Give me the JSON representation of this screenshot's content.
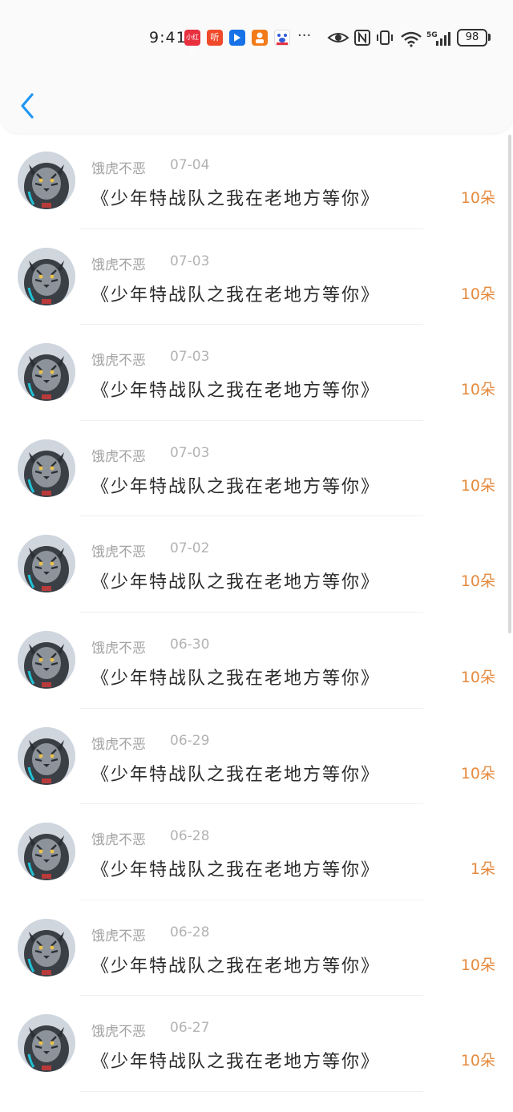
{
  "status_bar": {
    "time": "9:41",
    "apps": [
      {
        "name": "xiaohongshu-icon",
        "label": "小红书",
        "color": "#e8303f"
      },
      {
        "name": "listen-app-icon",
        "label": "听",
        "color": "#f04a2b"
      },
      {
        "name": "feishu-icon",
        "label": "",
        "color": "#1672e6"
      },
      {
        "name": "person-app-icon",
        "label": "",
        "color": "#f27b1b"
      },
      {
        "name": "baidu-icon",
        "label": "",
        "color": "#2f5bd7"
      }
    ],
    "more": "···",
    "battery": "98"
  },
  "list": {
    "items": [
      {
        "name": "饿虎不恶",
        "date": "07-04",
        "title": "《少年特战队之我在老地方等你》",
        "count": "10朵"
      },
      {
        "name": "饿虎不恶",
        "date": "07-03",
        "title": "《少年特战队之我在老地方等你》",
        "count": "10朵"
      },
      {
        "name": "饿虎不恶",
        "date": "07-03",
        "title": "《少年特战队之我在老地方等你》",
        "count": "10朵"
      },
      {
        "name": "饿虎不恶",
        "date": "07-03",
        "title": "《少年特战队之我在老地方等你》",
        "count": "10朵"
      },
      {
        "name": "饿虎不恶",
        "date": "07-02",
        "title": "《少年特战队之我在老地方等你》",
        "count": "10朵"
      },
      {
        "name": "饿虎不恶",
        "date": "06-30",
        "title": "《少年特战队之我在老地方等你》",
        "count": "10朵"
      },
      {
        "name": "饿虎不恶",
        "date": "06-29",
        "title": "《少年特战队之我在老地方等你》",
        "count": "10朵"
      },
      {
        "name": "饿虎不恶",
        "date": "06-28",
        "title": "《少年特战队之我在老地方等你》",
        "count": "1朵"
      },
      {
        "name": "饿虎不恶",
        "date": "06-28",
        "title": "《少年特战队之我在老地方等你》",
        "count": "10朵"
      },
      {
        "name": "饿虎不恶",
        "date": "06-27",
        "title": "《少年特战队之我在老地方等你》",
        "count": "10朵"
      }
    ]
  },
  "colors": {
    "accent": "#2196f3",
    "count": "#e58a3e"
  }
}
